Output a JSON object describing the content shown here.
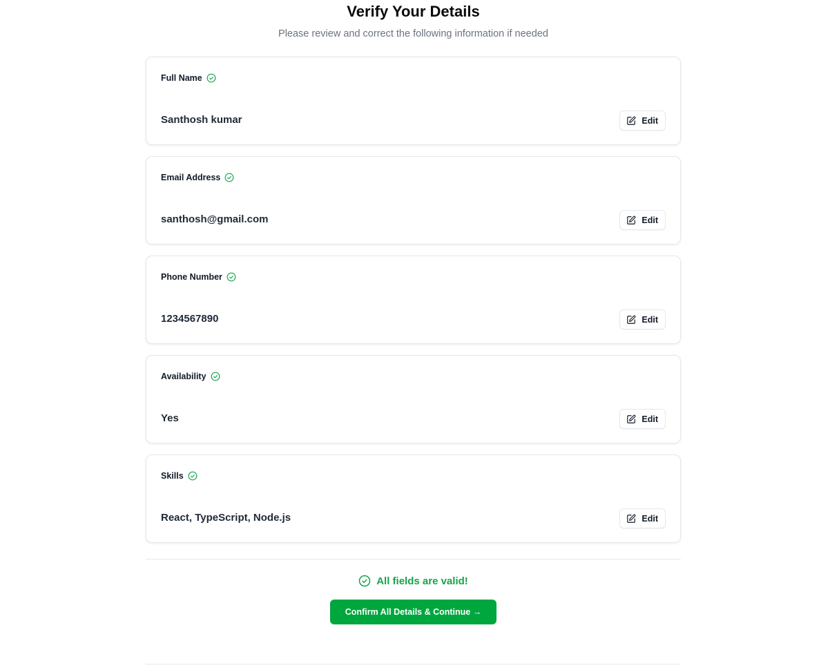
{
  "header": {
    "title": "Verify Your Details",
    "subtitle": "Please review and correct the following information if needed"
  },
  "fields": [
    {
      "label": "Full Name",
      "value": "Santhosh kumar",
      "edit_label": "Edit",
      "valid": true
    },
    {
      "label": "Email Address",
      "value": "santhosh@gmail.com",
      "edit_label": "Edit",
      "valid": true
    },
    {
      "label": "Phone Number",
      "value": "1234567890",
      "edit_label": "Edit",
      "valid": true
    },
    {
      "label": "Availability",
      "value": "Yes",
      "edit_label": "Edit",
      "valid": true
    },
    {
      "label": "Skills",
      "value": "React, TypeScript, Node.js",
      "edit_label": "Edit",
      "valid": true
    }
  ],
  "footer": {
    "status_text": "All fields are valid!",
    "confirm_label": "Confirm All Details & Continue →"
  },
  "icons": {
    "field_check": "check-circle-icon",
    "edit": "edit-icon",
    "status_check": "check-circle-icon"
  },
  "colors": {
    "success": "#16a34a",
    "confirm_button": "#00a63e",
    "border": "#e5e7eb",
    "subtitle": "#6b7280"
  }
}
